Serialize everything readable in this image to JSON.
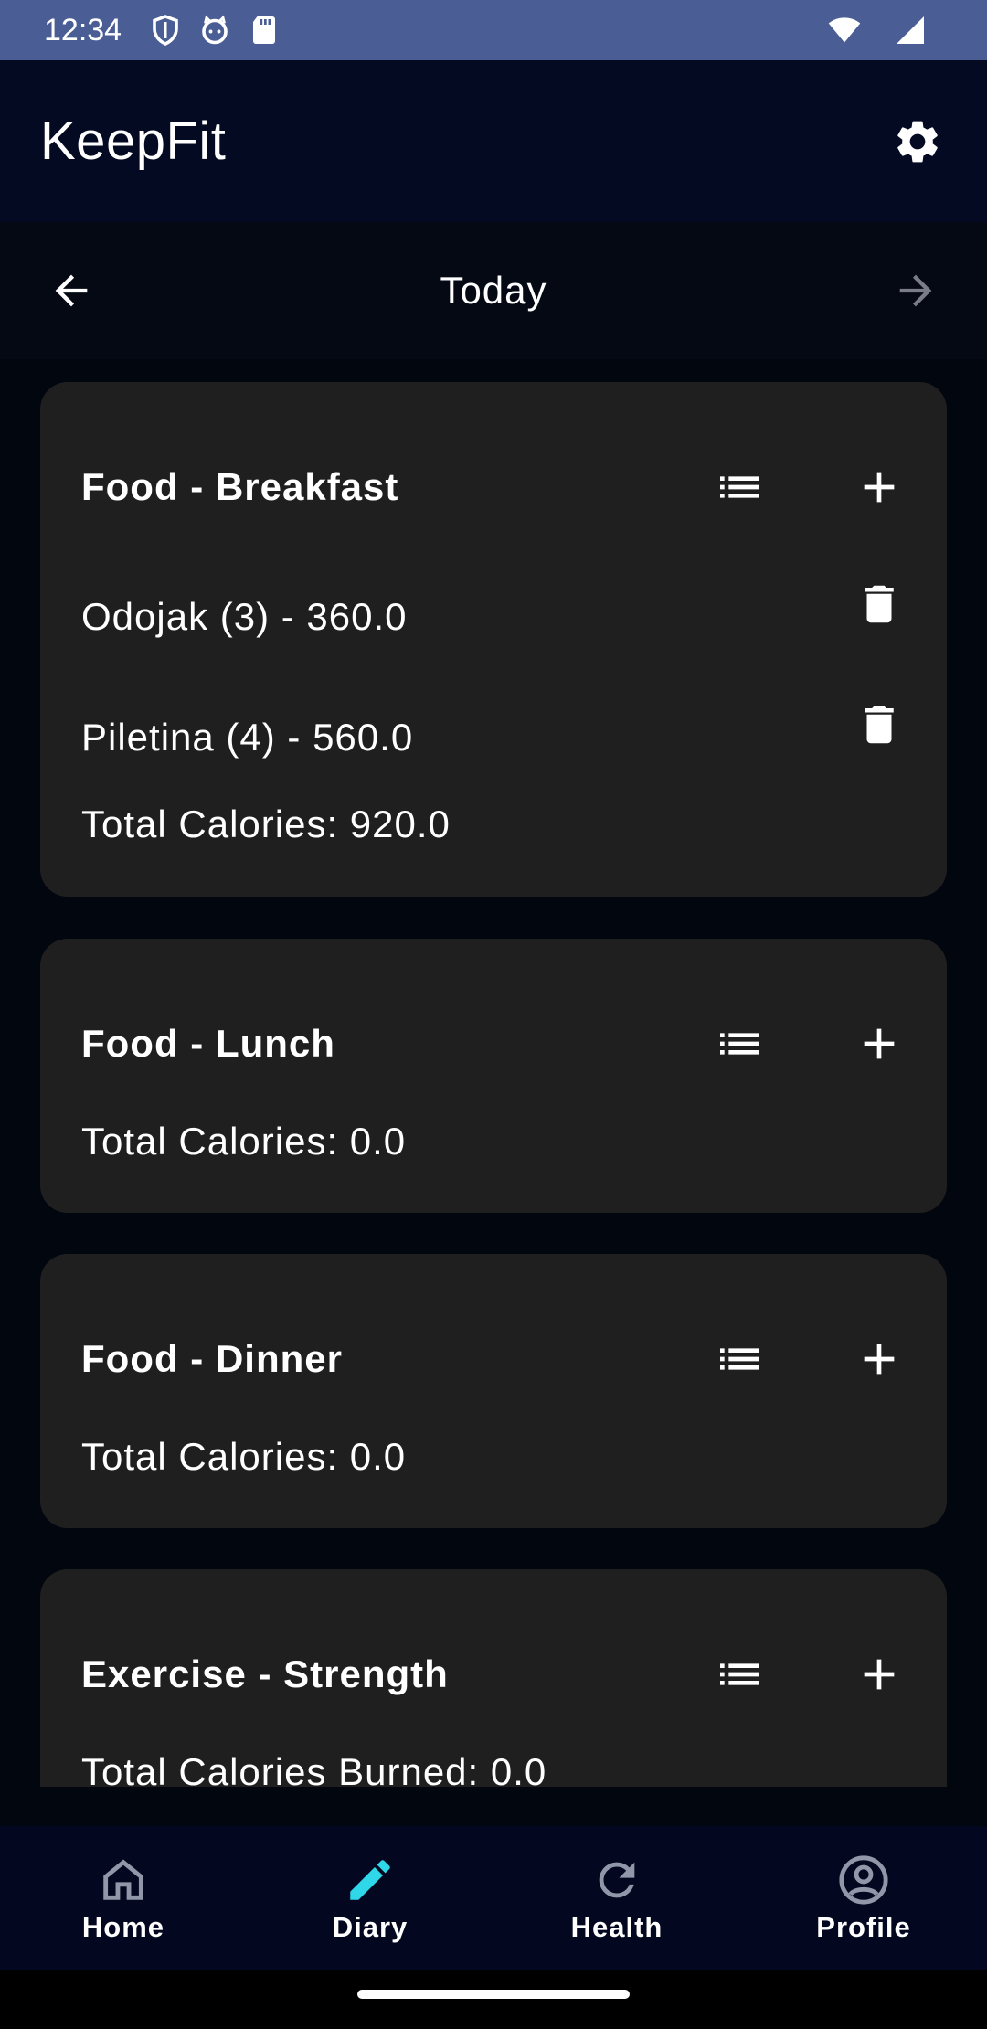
{
  "status_bar": {
    "time": "12:34"
  },
  "app_bar": {
    "title": "KeepFit"
  },
  "date_nav": {
    "label": "Today"
  },
  "cards": [
    {
      "title": "Food - Breakfast",
      "entries": [
        "Odojak (3) - 360.0",
        "Piletina (4) - 560.0"
      ],
      "total": "Total Calories: 920.0"
    },
    {
      "title": "Food - Lunch",
      "entries": [],
      "total": "Total Calories: 0.0"
    },
    {
      "title": "Food - Dinner",
      "entries": [],
      "total": "Total Calories: 0.0"
    },
    {
      "title": "Exercise - Strength",
      "entries": [],
      "total": "Total Calories Burned: 0.0"
    }
  ],
  "bottom_nav": {
    "items": [
      {
        "label": "Home",
        "icon": "home-icon"
      },
      {
        "label": "Diary",
        "icon": "pencil-icon",
        "active": true
      },
      {
        "label": "Health",
        "icon": "refresh-icon"
      },
      {
        "label": "Profile",
        "icon": "account-icon"
      }
    ]
  },
  "colors": {
    "status_bar": "#4a5d94",
    "app_bar": "#040a22",
    "card": "#1f1f1f",
    "active_nav": "#2fd8e8",
    "background": "#02060f"
  }
}
